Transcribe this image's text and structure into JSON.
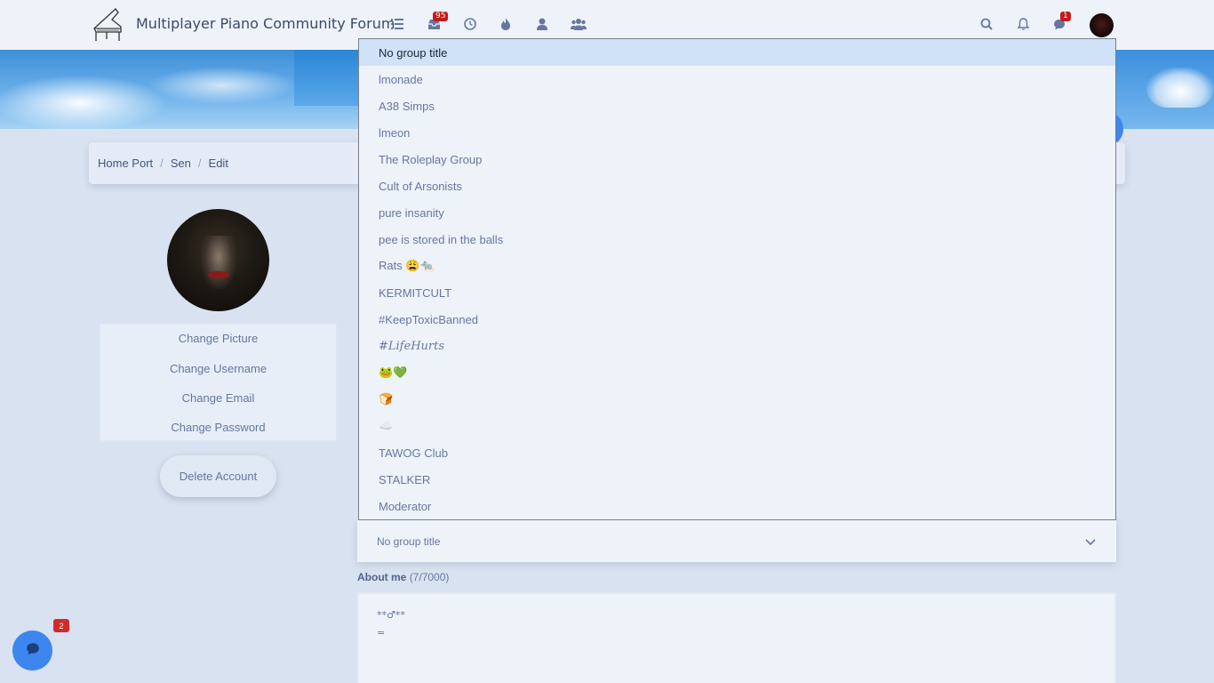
{
  "header": {
    "title": "Multiplayer Piano Community Forum",
    "badges": {
      "unread": "95",
      "chats": "1"
    }
  },
  "breadcrumb": {
    "items": [
      "Home Port",
      "Sen",
      "Edit"
    ]
  },
  "account_menu": {
    "change_picture": "Change Picture",
    "change_username": "Change Username",
    "change_email": "Change Email",
    "change_password": "Change Password",
    "delete_account": "Delete Account"
  },
  "group_title": {
    "selected_value": "No group title",
    "options": [
      "No group title",
      "lmonade",
      "A38 Simps",
      "lmeon",
      "The Roleplay Group",
      "Cult of Arsonists",
      "pure insanity",
      "pee is stored in the balls",
      "Rats 😩🐀",
      "KERMITCULT",
      "#KeepToxicBanned",
      "#LifeHurts",
      "🐸💚",
      "🍞",
      "☁️",
      "TAWOG Club",
      "STALKER",
      "Moderator"
    ]
  },
  "about_me": {
    "label": "About me",
    "count": "(7/7000)",
    "lines": [
      "**♂**",
      "="
    ]
  },
  "chat": {
    "badge": "2"
  },
  "colors": {
    "accent": "#3d86f0",
    "badge": "#c41a1a",
    "selected_row": "#cfe2f7"
  }
}
